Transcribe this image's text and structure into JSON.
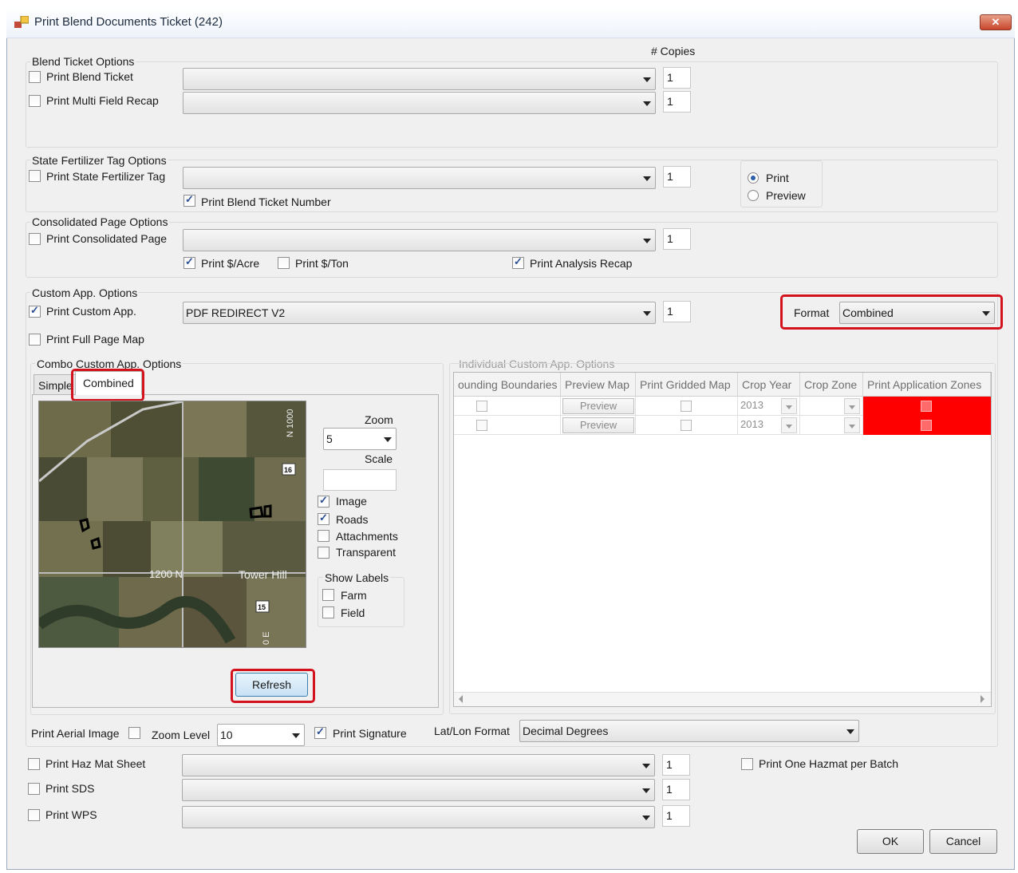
{
  "window": {
    "title": "Print Blend Documents  Ticket (242)",
    "close_label": "✕"
  },
  "copies_header": "# Copies",
  "blend": {
    "group_label": "Blend Ticket Options",
    "print_blend_ticket": {
      "label": "Print Blend Ticket",
      "checked": false,
      "value": "",
      "copies": "1"
    },
    "print_multi_field": {
      "label": "Print Multi Field Recap",
      "checked": false,
      "value": "",
      "copies": "1"
    }
  },
  "state": {
    "group_label": "State Fertilizer Tag Options",
    "print_tag": {
      "label": "Print State Fertilizer Tag",
      "checked": false,
      "value": "",
      "copies": "1"
    },
    "print_ticket_number": {
      "label": "Print Blend Ticket Number",
      "checked": true
    },
    "mode": {
      "print": "Print",
      "preview": "Preview",
      "selected": "Print"
    }
  },
  "consolidated": {
    "group_label": "Consolidated Page Options",
    "print_page": {
      "label": "Print Consolidated Page",
      "checked": false,
      "value": "",
      "copies": "1"
    },
    "per_acre": {
      "label": "Print $/Acre",
      "checked": true
    },
    "per_ton": {
      "label": "Print $/Ton",
      "checked": false
    },
    "analysis_recap": {
      "label": "Print Analysis Recap",
      "checked": true
    }
  },
  "custom": {
    "group_label": "Custom App. Options",
    "print_custom": {
      "label": "Print Custom App.",
      "checked": true,
      "value": "PDF REDIRECT V2",
      "copies": "1"
    },
    "full_page_map": {
      "label": "Print Full Page Map",
      "checked": false
    },
    "format_label": "Format",
    "format_value": "Combined"
  },
  "combo": {
    "group_label": "Combo Custom App. Options",
    "tabs": [
      "Simple",
      "Combined"
    ],
    "active_tab": "Combined",
    "zoom_label": "Zoom",
    "zoom_value": "5",
    "scale_label": "Scale",
    "scale_value": "",
    "layers": [
      {
        "label": "Image",
        "checked": true
      },
      {
        "label": "Roads",
        "checked": true
      },
      {
        "label": "Attachments",
        "checked": false
      },
      {
        "label": "Transparent",
        "checked": false
      }
    ],
    "show_labels": {
      "title": "Show Labels",
      "farm": "Farm",
      "field": "Field"
    },
    "refresh_label": "Refresh",
    "map_labels": {
      "road1": "1200 N",
      "town": "Tower Hill",
      "road2": "N 1000",
      "road3": "0 E",
      "shield1": "16",
      "shield2": "15"
    }
  },
  "individual": {
    "group_label": "Individual Custom App. Options",
    "columns": [
      "ounding Boundaries",
      "Preview Map",
      "Print Gridded Map",
      "Crop Year",
      "Crop Zone",
      "Print Application Zones"
    ],
    "rows": [
      {
        "preview": "Preview",
        "year": "2013"
      },
      {
        "preview": "Preview",
        "year": "2013"
      }
    ]
  },
  "bottom": {
    "aerial_label": "Print Aerial Image",
    "zoom_level_label": "Zoom Level",
    "zoom_level_value": "10",
    "signature_label": "Print Signature",
    "latlon_label": "Lat/Lon Format",
    "latlon_value": "Decimal Degrees",
    "hazmat": {
      "label": "Print Haz Mat Sheet",
      "copies": "1"
    },
    "sds": {
      "label": "Print SDS",
      "copies": "1"
    },
    "wps": {
      "label": "Print WPS",
      "copies": "1"
    },
    "one_hazmat": "Print One Hazmat per Batch",
    "ok_label": "OK",
    "cancel_label": "Cancel"
  }
}
